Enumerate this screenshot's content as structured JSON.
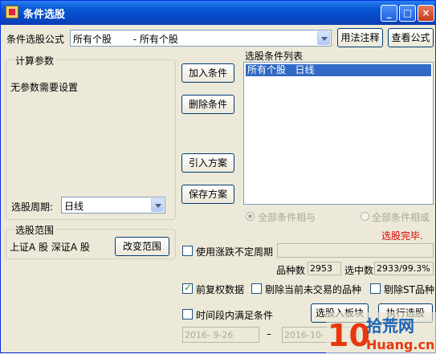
{
  "window": {
    "title": "条件选股"
  },
  "formula": {
    "label": "条件选股公式",
    "selected": "所有个股       - 所有个股",
    "usage_button": "用法注释",
    "view_button": "查看公式"
  },
  "params": {
    "legend": "计算参数",
    "none_text": "无参数需要设置",
    "period_label": "选股周期:",
    "period_value": "日线"
  },
  "actions": {
    "add": "加入条件",
    "delete": "删除条件",
    "import": "引入方案",
    "save": "保存方案"
  },
  "condition_list": {
    "label": "选股条件列表",
    "items": [
      "所有个股   日线"
    ]
  },
  "logic": {
    "and_label": "全部条件相与",
    "or_label": "全部条件相或"
  },
  "status": {
    "done": "选股完毕.",
    "done_color": "#e00000"
  },
  "range": {
    "legend": "选股范围",
    "value": "上证A 股  深证A 股",
    "change_button": "改变范围"
  },
  "options": {
    "uncertain_period": "使用涨跌不定周期",
    "count_label": "品种数",
    "count_value": "2953",
    "selected_label": "选中数",
    "selected_value": "2933/99.3%",
    "pre_adjust": "前复权数据",
    "exclude_untraded": "剔除当前未交易的品种",
    "exclude_st": "剔除ST品种",
    "time_range": "时间段内满足条件",
    "date_from": "2016- 9-26",
    "dash": "–",
    "date_to": "2016-10-",
    "to_block_button": "选股入板块",
    "run_button": "执行选股"
  },
  "watermark": {
    "digits": "10",
    "brand": "拾荒网",
    "site": "Huang.cn",
    "accent": "#e8380d",
    "brand_color": "#1a63b6"
  }
}
